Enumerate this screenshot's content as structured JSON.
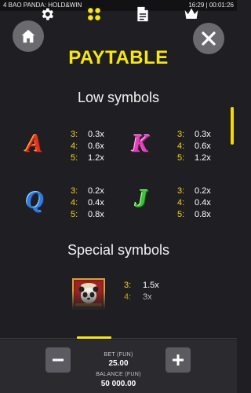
{
  "topbar": {
    "title": "4 BAO PANDA: HOLD&WIN",
    "clock": "16:29 | 00:01:26"
  },
  "header": {
    "title": "PAYTABLE"
  },
  "low_section": {
    "title": "Low symbols",
    "symbols": [
      {
        "glyph": "A",
        "color": "#e3321d",
        "pays": [
          {
            "count": "3:",
            "value": "0.3x"
          },
          {
            "count": "4:",
            "value": "0.6x"
          },
          {
            "count": "5:",
            "value": "1.2x"
          }
        ]
      },
      {
        "glyph": "K",
        "color": "#e242b8",
        "pays": [
          {
            "count": "3:",
            "value": "0.3x"
          },
          {
            "count": "4:",
            "value": "0.6x"
          },
          {
            "count": "5:",
            "value": "1.2x"
          }
        ]
      },
      {
        "glyph": "Q",
        "color": "#2f7dde",
        "pays": [
          {
            "count": "3:",
            "value": "0.2x"
          },
          {
            "count": "4:",
            "value": "0.4x"
          },
          {
            "count": "5:",
            "value": "0.8x"
          }
        ]
      },
      {
        "glyph": "J",
        "color": "#39c63b",
        "pays": [
          {
            "count": "3:",
            "value": "0.2x"
          },
          {
            "count": "4:",
            "value": "0.4x"
          },
          {
            "count": "5:",
            "value": "0.8x"
          }
        ]
      }
    ]
  },
  "special_section": {
    "title": "Special symbols",
    "symbols": [
      {
        "icon": "panda-symbol-icon",
        "pays": [
          {
            "count": "3:",
            "value": "1.5x"
          },
          {
            "count": "4:",
            "value": "3x"
          }
        ]
      }
    ]
  },
  "tabs": [
    {
      "icon": "gear-icon"
    },
    {
      "icon": "paytable-grid-icon",
      "active": true
    },
    {
      "icon": "document-icon"
    },
    {
      "icon": "crown-icon"
    }
  ],
  "bet": {
    "label": "BET (FUN)",
    "value": "25.00"
  },
  "balance": {
    "label": "BALANCE (FUN)",
    "value": "50 000.00"
  },
  "colors": {
    "accent": "#f7e617",
    "background": "#1f1f23",
    "panel": "#2a2a2f"
  }
}
